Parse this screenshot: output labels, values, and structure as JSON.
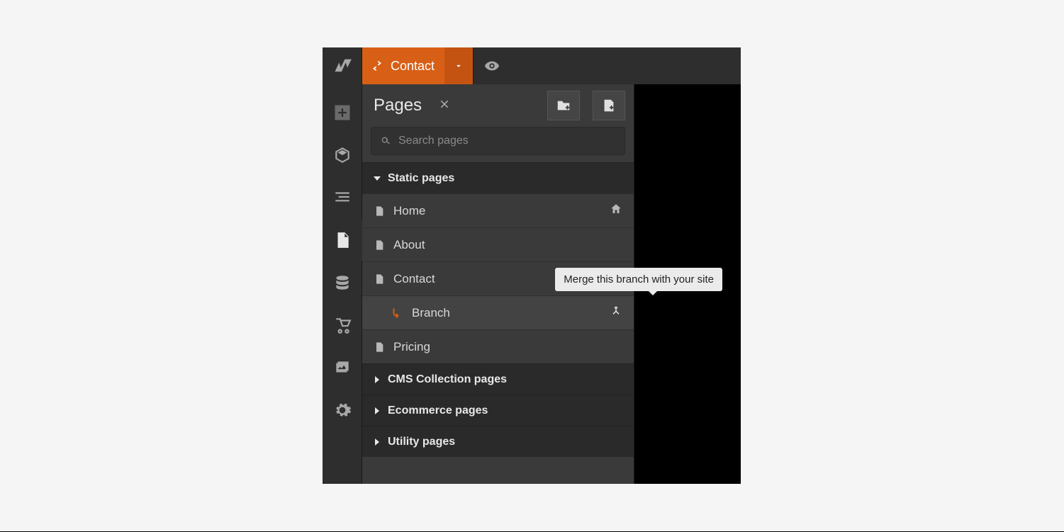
{
  "topbar": {
    "current_page_label": "Contact"
  },
  "panel": {
    "title": "Pages",
    "search_placeholder": "Search pages"
  },
  "sections": {
    "static": {
      "label": "Static pages"
    },
    "cms": {
      "label": "CMS Collection pages"
    },
    "ecom": {
      "label": "Ecommerce pages"
    },
    "util": {
      "label": "Utility pages"
    }
  },
  "pages": {
    "home": {
      "label": "Home"
    },
    "about": {
      "label": "About"
    },
    "contact": {
      "label": "Contact"
    },
    "branch": {
      "label": "Branch"
    },
    "pricing": {
      "label": "Pricing"
    }
  },
  "tooltip": {
    "merge": "Merge this branch with your site"
  }
}
